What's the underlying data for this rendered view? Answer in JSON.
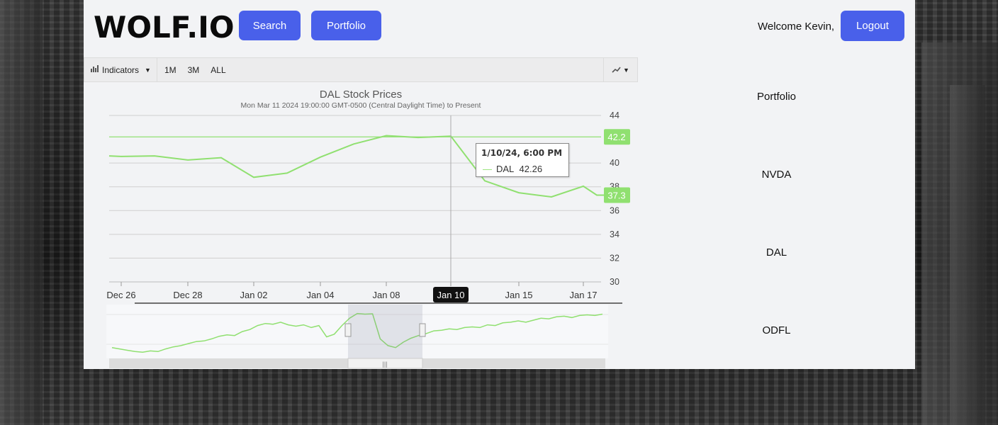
{
  "header": {
    "logo": "WOLF.IO",
    "search_label": "Search",
    "portfolio_label": "Portfolio",
    "welcome": "Welcome Kevin,",
    "logout_label": "Logout"
  },
  "toolbar": {
    "indicators_label": "Indicators",
    "ranges": [
      "1M",
      "3M",
      "ALL"
    ]
  },
  "sidebar": {
    "title": "Portfolio",
    "items": [
      "NVDA",
      "DAL",
      "ODFL"
    ]
  },
  "tooltip": {
    "date": "1/10/24, 6:00 PM",
    "series": "DAL",
    "value": "42.26"
  },
  "colors": {
    "accent": "#4960ea",
    "line": "#90e070"
  },
  "chart_data": {
    "type": "line",
    "title": "DAL Stock Prices",
    "subtitle": "Mon Mar 11 2024 19:00:00 GMT-0500 (Central Daylight Time) to Present",
    "x_ticks": [
      "Dec 26",
      "Dec 28",
      "Jan 02",
      "Jan 04",
      "Jan 08",
      "Jan 10",
      "Jan 15",
      "Jan 17"
    ],
    "highlighted_x_tick": "Jan 10",
    "y_ticks": [
      30,
      32,
      34,
      36,
      38,
      40,
      44
    ],
    "ylim": [
      30,
      44
    ],
    "series": [
      {
        "name": "DAL",
        "x": [
          "Dec 22",
          "Dec 26",
          "Dec 27",
          "Dec 28",
          "Dec 29",
          "Jan 02",
          "Jan 03",
          "Jan 04",
          "Jan 05",
          "Jan 08",
          "Jan 09",
          "Jan 10",
          "Jan 11",
          "Jan 12",
          "Jan 15",
          "Jan 16",
          "Jan 17",
          "Jan 18"
        ],
        "values": [
          40.6,
          40.55,
          40.6,
          40.25,
          40.45,
          38.8,
          39.15,
          40.5,
          41.6,
          42.3,
          42.15,
          42.26,
          38.5,
          37.5,
          37.15,
          38.05,
          37.3,
          37.3
        ]
      }
    ],
    "price_labels": [
      "42.2",
      "37.3"
    ],
    "price_levels": [
      42.2,
      37.3
    ],
    "grid": true,
    "navigator": {
      "values": [
        37.2,
        37.0,
        36.8,
        36.6,
        36.5,
        36.7,
        36.6,
        37.0,
        37.3,
        37.5,
        37.8,
        38.1,
        38.2,
        38.5,
        38.9,
        39.1,
        39.0,
        39.6,
        39.9,
        40.5,
        40.8,
        40.7,
        41.0,
        40.6,
        40.4,
        40.6,
        40.2,
        40.5,
        38.8,
        39.2,
        40.5,
        41.6,
        42.3,
        42.2,
        42.26,
        38.5,
        37.5,
        37.2,
        38.0,
        38.6,
        39.0,
        39.3,
        39.7,
        39.8,
        40.0,
        39.9,
        40.2,
        40.3,
        40.2,
        40.6,
        40.5,
        40.9,
        41.0,
        41.2,
        41.0,
        41.3,
        41.6,
        41.5,
        41.8,
        41.9,
        41.7,
        42.0,
        42.1,
        42.0,
        42.2
      ]
    }
  }
}
